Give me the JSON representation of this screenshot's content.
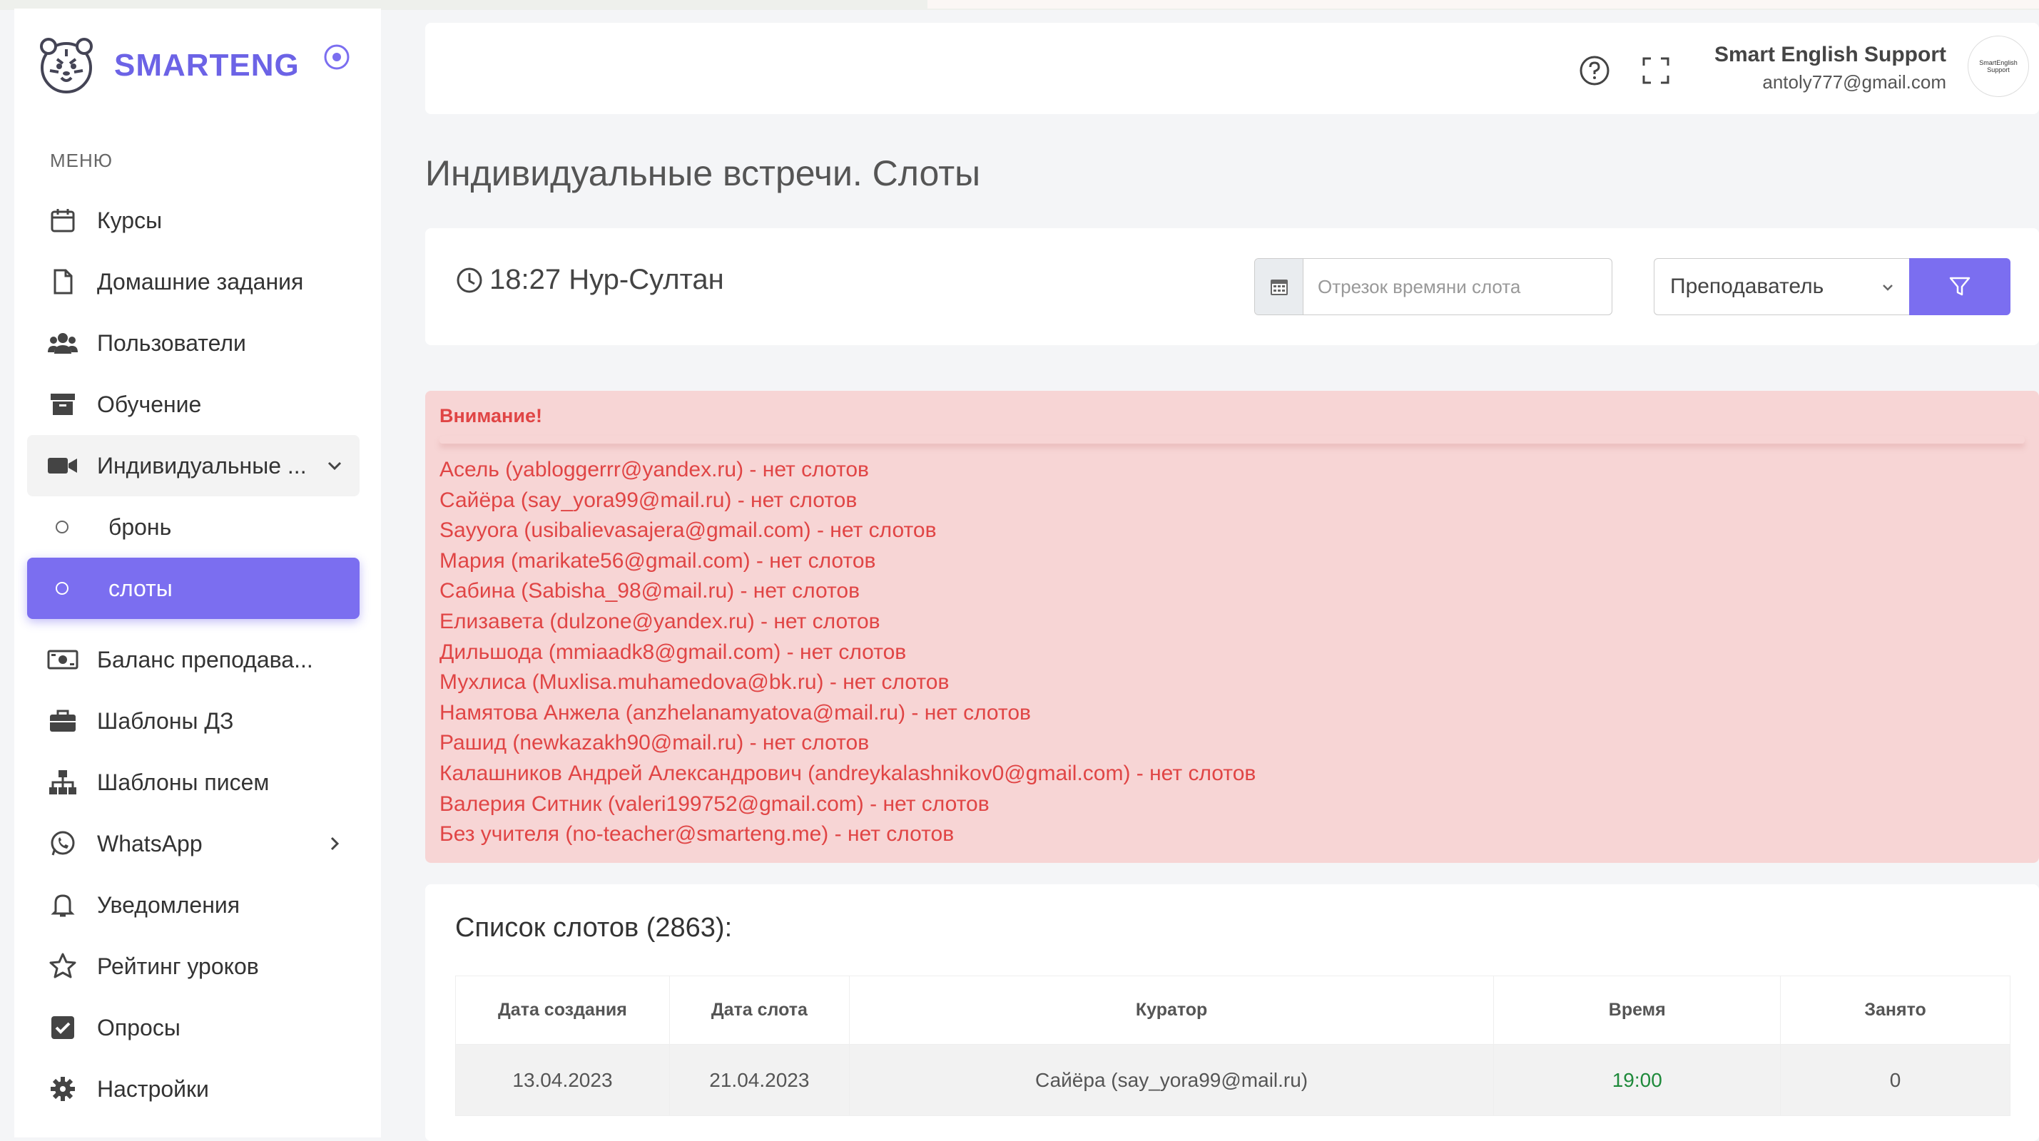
{
  "brand": {
    "name": "SMARTENG"
  },
  "sidebar": {
    "menu_header": "МЕНЮ",
    "items": [
      {
        "label": "Курсы",
        "icon": "calendar-icon"
      },
      {
        "label": "Домашние задания",
        "icon": "file-icon"
      },
      {
        "label": "Пользователи",
        "icon": "users-icon"
      },
      {
        "label": "Обучение",
        "icon": "archive-icon"
      },
      {
        "label": "Индивидуальные ...",
        "icon": "video-icon",
        "expanded": true
      },
      {
        "label": "бронь",
        "sub": true
      },
      {
        "label": "слоты",
        "sub": true,
        "active": true
      },
      {
        "label": "Баланс преподава...",
        "icon": "money-icon"
      },
      {
        "label": "Шаблоны ДЗ",
        "icon": "briefcase-icon"
      },
      {
        "label": "Шаблоны писем",
        "icon": "sitemap-icon"
      },
      {
        "label": "WhatsApp",
        "icon": "whatsapp-icon"
      },
      {
        "label": "Уведомления",
        "icon": "bell-icon"
      },
      {
        "label": "Рейтинг уроков",
        "icon": "star-icon"
      },
      {
        "label": "Опросы",
        "icon": "checkbox-icon"
      },
      {
        "label": "Настройки",
        "icon": "gear-icon"
      }
    ]
  },
  "header": {
    "user_name": "Smart English Support",
    "user_email": "antoly777@gmail.com",
    "avatar_text": "SmartEnglish Support"
  },
  "page": {
    "title": "Индивидуальные встречи. Слоты"
  },
  "filter": {
    "clock_text": "18:27 Нур-Султан",
    "date_placeholder": "Отрезок времяни слота",
    "teacher_select": "Преподаватель"
  },
  "alert": {
    "title": "Внимание!",
    "lines": [
      "Асель (yabloggerrr@yandex.ru) - нет слотов",
      "Сайёра (say_yora99@mail.ru) - нет слотов",
      "Sayyora (usibalievasajera@gmail.com) - нет слотов",
      "Мария (marikate56@gmail.com) - нет слотов",
      "Сабина (Sabisha_98@mail.ru) - нет слотов",
      "Елизавета (dulzone@yandex.ru) - нет слотов",
      "Дильшода (mmiaadk8@gmail.com) - нет слотов",
      "Мухлиса (Muxlisa.muhamedova@bk.ru) - нет слотов",
      "Намятова Анжела (anzhelanamyatova@mail.ru) - нет слотов",
      "Рашид (newkazakh90@mail.ru) - нет слотов",
      "Калашников Андрей Александрович (andreykalashnikov0@gmail.com) - нет слотов",
      "Валерия Ситник (valeri199752@gmail.com) - нет слотов",
      "Без учителя (no-teacher@smarteng.me) - нет слотов"
    ]
  },
  "slots": {
    "title": "Список слотов (2863):",
    "columns": [
      "Дата создания",
      "Дата слота",
      "Куратор",
      "Время",
      "Занято"
    ],
    "rows": [
      [
        "13.04.2023",
        "21.04.2023",
        "Сайёра (say_yora99@mail.ru)",
        "19:00",
        "0"
      ]
    ]
  },
  "colors": {
    "accent": "#7b6ef0",
    "alert_bg": "#f7d5d5",
    "alert_text": "#e04545",
    "time_green": "#1f8a3b"
  }
}
